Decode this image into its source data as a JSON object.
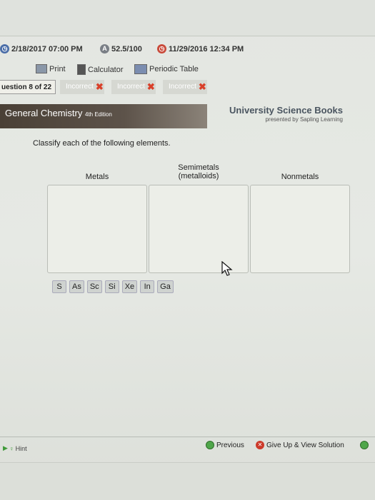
{
  "status": {
    "due_date": "2/18/2017 07:00 PM",
    "score": "52.5/100",
    "timestamp": "11/29/2016 12:34 PM"
  },
  "toolbar": {
    "print_label": "Print",
    "calculator_label": "Calculator",
    "periodic_table_label": "Periodic Table"
  },
  "question_nav": {
    "question_label": "uestion 8 of 22",
    "attempts": [
      {
        "label": "Incorrect"
      },
      {
        "label": "Incorrect"
      },
      {
        "label": "Incorrect"
      }
    ]
  },
  "banner": {
    "book_title": "General Chemistry",
    "edition": "4th Edition",
    "publisher": "University Science Books",
    "presented_by": "presented by Sapling Learning"
  },
  "question": {
    "instruction": "Classify each of the following elements.",
    "categories": [
      {
        "label": "Metals"
      },
      {
        "label_line1": "Semimetals",
        "label_line2": "(metalloids)"
      },
      {
        "label": "Nonmetals"
      }
    ],
    "elements": [
      "S",
      "As",
      "Sc",
      "Si",
      "Xe",
      "In",
      "Ga"
    ]
  },
  "footer": {
    "hint_label": "Hint",
    "previous_label": "Previous",
    "give_up_label": "Give Up & View Solution"
  }
}
